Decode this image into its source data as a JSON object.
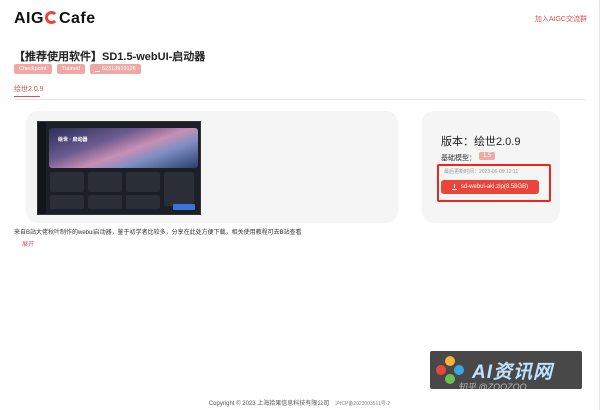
{
  "header": {
    "logo_left": "AIG",
    "logo_right": "Cafe",
    "join_link": "加入AIGC交流群"
  },
  "title": "【推荐使用软件】SD1.5-webUI-启动器",
  "tags": [
    "Checkpoint",
    "Trained",
    "52313919126"
  ],
  "tab_label": "绘世2.0.9",
  "preview": {
    "hero_title": "绘世 · 启动器"
  },
  "info": {
    "version": "版本：绘世2.0.9",
    "base_model_label": "基础模型：",
    "base_model_value": "1.5",
    "updated": "最后更新时间：2023-06-09 12:11",
    "download_label": "sd-webui-aki.zip(8.58GB)"
  },
  "description": "来自B站大佬秋叶制作的webui启动器，鉴于初学者比较多，分享在此处方便下载，相关使用教程可去B站查看",
  "expand_label": "展开",
  "footer": {
    "copyright": "Copyright © 2023 上海拾果信息科技有限公司",
    "icp": "沪ICP备2023003511号-2"
  },
  "watermark": {
    "text": "AI资讯网",
    "sub": "知乎 @ZOOZOO"
  },
  "colors": {
    "accent": "#e8463b",
    "tag_bg": "#f0a8a4",
    "panel_bg": "#f5f5f5",
    "highlight": "#e8271d"
  }
}
